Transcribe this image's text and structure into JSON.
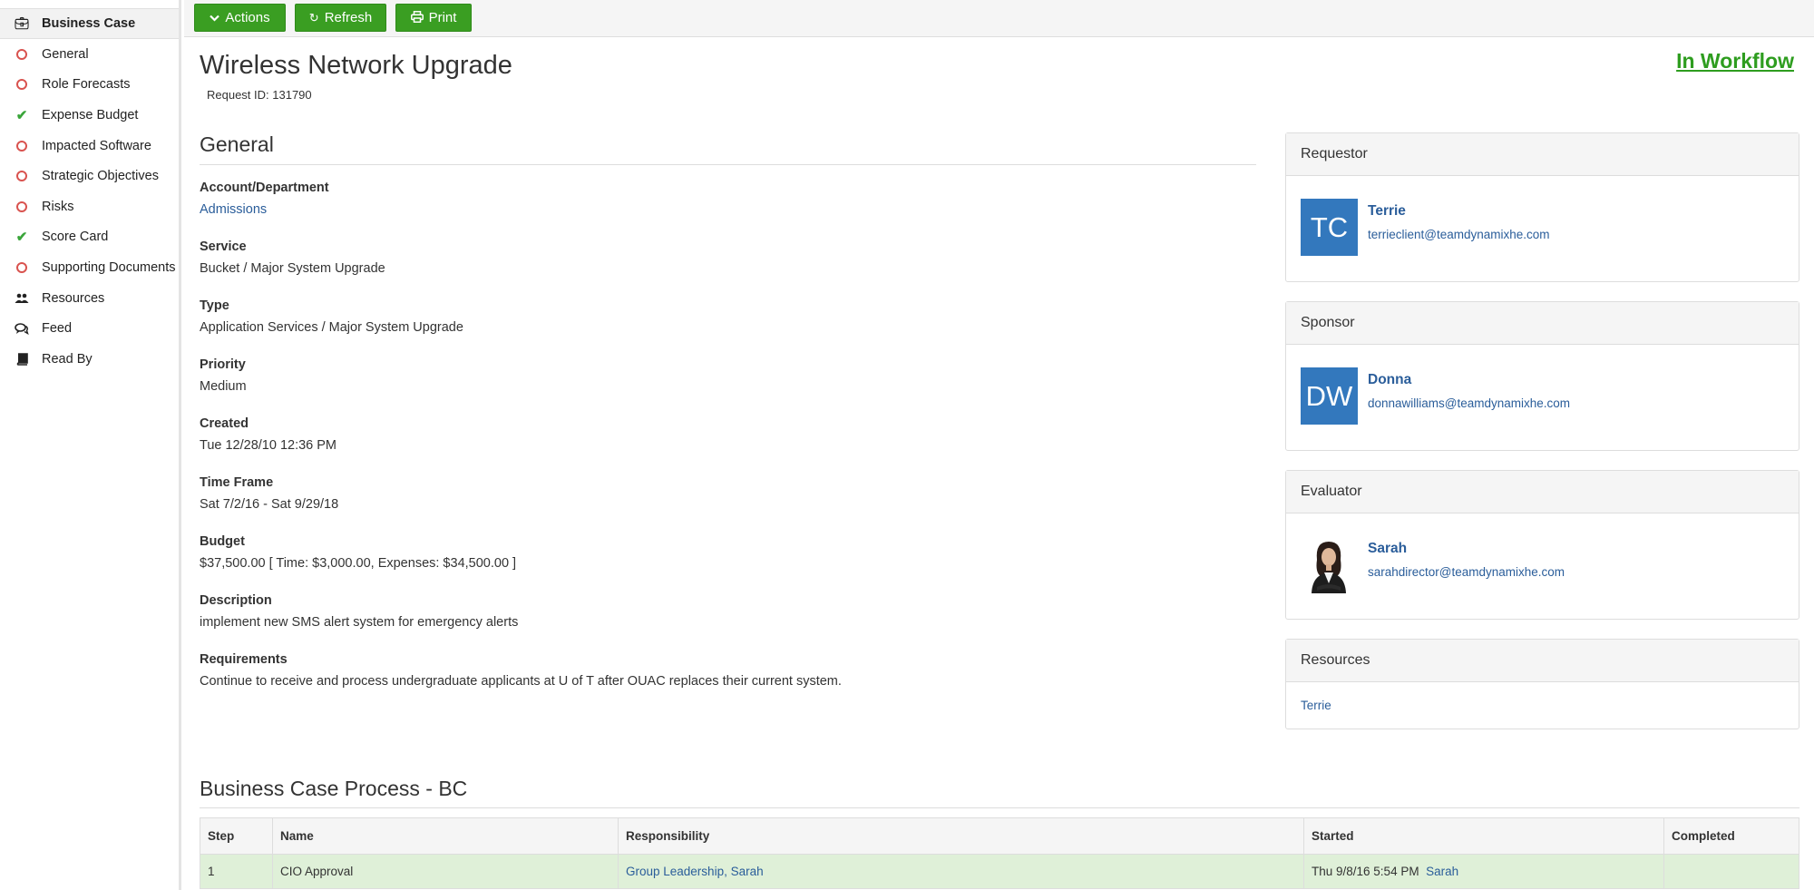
{
  "sidebar": {
    "items": [
      {
        "label": "Business Case",
        "icon": "briefcase-icon",
        "state": "active"
      },
      {
        "label": "General",
        "icon": "circle-icon",
        "state": "incomplete"
      },
      {
        "label": "Role Forecasts",
        "icon": "circle-icon",
        "state": "incomplete"
      },
      {
        "label": "Expense Budget",
        "icon": "check-icon",
        "state": "complete"
      },
      {
        "label": "Impacted Software",
        "icon": "circle-icon",
        "state": "incomplete"
      },
      {
        "label": "Strategic Objectives",
        "icon": "circle-icon",
        "state": "incomplete"
      },
      {
        "label": "Risks",
        "icon": "circle-icon",
        "state": "incomplete"
      },
      {
        "label": "Score Card",
        "icon": "check-icon",
        "state": "complete"
      },
      {
        "label": "Supporting Documents",
        "icon": "circle-icon",
        "state": "incomplete"
      },
      {
        "label": "Resources",
        "icon": "users-icon",
        "state": "neutral"
      },
      {
        "label": "Feed",
        "icon": "comments-icon",
        "state": "neutral"
      },
      {
        "label": "Read By",
        "icon": "book-icon",
        "state": "neutral"
      }
    ]
  },
  "toolbar": {
    "actions_label": "Actions",
    "refresh_label": "Refresh",
    "print_label": "Print"
  },
  "header": {
    "title": "Wireless Network Upgrade",
    "request_id": "Request ID: 131790",
    "status": "In Workflow"
  },
  "general": {
    "section_title": "General",
    "fields": [
      {
        "label": "Account/Department",
        "value": "Admissions"
      },
      {
        "label": "Service",
        "value": "Bucket / Major System Upgrade"
      },
      {
        "label": "Type",
        "value": "Application Services / Major System Upgrade"
      },
      {
        "label": "Priority",
        "value": "Medium"
      },
      {
        "label": "Created",
        "value": "Tue 12/28/10 12:36 PM"
      },
      {
        "label": "Time Frame",
        "value": "Sat 7/2/16 - Sat 9/29/18"
      },
      {
        "label": "Budget",
        "value": "$37,500.00 [ Time: $3,000.00, Expenses: $34,500.00 ]"
      },
      {
        "label": "Description",
        "value": "implement new SMS alert system for emergency alerts"
      },
      {
        "label": "Requirements",
        "value": "Continue to receive and process undergraduate applicants at U of T after OUAC replaces their current system."
      }
    ]
  },
  "people": {
    "requestor": {
      "heading": "Requestor",
      "initials": "TC",
      "name": "Terrie",
      "email": "terrieclient@teamdynamixhe.com"
    },
    "sponsor": {
      "heading": "Sponsor",
      "initials": "DW",
      "name": "Donna",
      "email": "donnawilliams@teamdynamixhe.com"
    },
    "evaluator": {
      "heading": "Evaluator",
      "name": "Sarah",
      "email": "sarahdirector@teamdynamixhe.com"
    },
    "resources": {
      "heading": "Resources",
      "items": [
        "Terrie"
      ]
    }
  },
  "process": {
    "title": "Business Case Process - BC",
    "columns": [
      "Step",
      "Name",
      "Responsibility",
      "Started",
      "Completed"
    ],
    "rows": [
      {
        "step": "1",
        "name": "CIO Approval",
        "responsibility": "Group Leadership, Sarah",
        "started": "Thu 9/8/16 5:54 PM",
        "started_by": "Sarah",
        "completed": ""
      }
    ]
  },
  "colors": {
    "button_green": "#3a9e22",
    "status_green": "#2e9d1f",
    "avatar_blue": "#3378bd",
    "row_highlight": "#dff0d8",
    "link_blue": "#2a5d9a"
  }
}
